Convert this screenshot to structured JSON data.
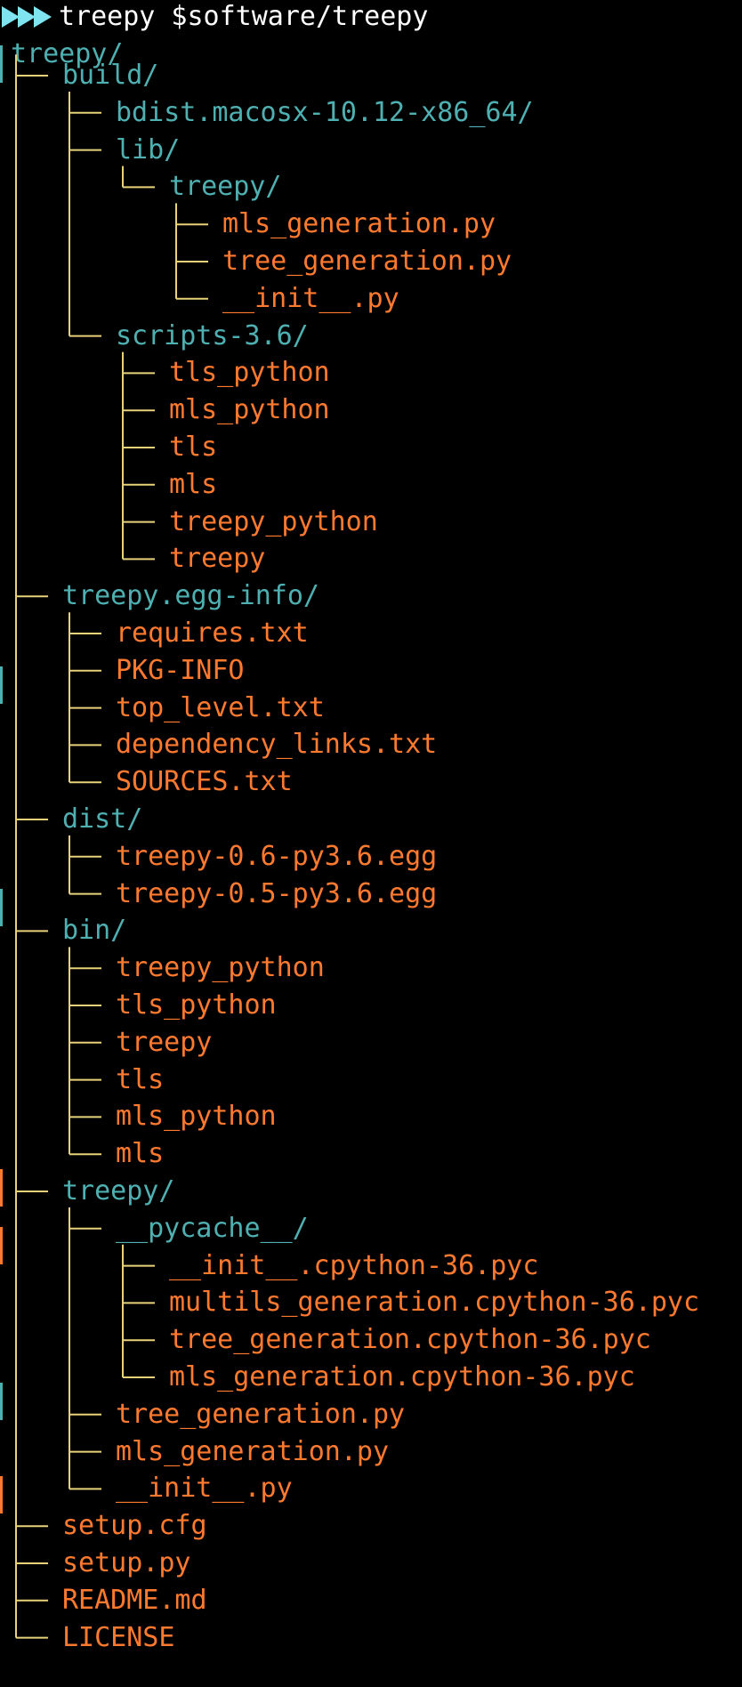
{
  "colors": {
    "background": "#000000",
    "prompt": "#ffffff",
    "dir": "#4fb0b2",
    "file": "#ff7a2f",
    "connector": "#e8d27a",
    "prompt_icon": "#7fe3f0"
  },
  "prompt": {
    "icon": "double-triangle-prompt-icon",
    "text": "treepy $software/treepy"
  },
  "root": {
    "label": "treepy/"
  },
  "tree": [
    {
      "label": "build/",
      "type": "dir",
      "children": [
        {
          "label": "bdist.macosx-10.12-x86_64/",
          "type": "dir"
        },
        {
          "label": "lib/",
          "type": "dir",
          "children": [
            {
              "label": "treepy/",
              "type": "dir",
              "children": [
                {
                  "label": "mls_generation.py",
                  "type": "file"
                },
                {
                  "label": "tree_generation.py",
                  "type": "file"
                },
                {
                  "label": "__init__.py",
                  "type": "file"
                }
              ]
            }
          ]
        },
        {
          "label": "scripts-3.6/",
          "type": "dir",
          "children": [
            {
              "label": "tls_python",
              "type": "file"
            },
            {
              "label": "mls_python",
              "type": "file"
            },
            {
              "label": "tls",
              "type": "file"
            },
            {
              "label": "mls",
              "type": "file"
            },
            {
              "label": "treepy_python",
              "type": "file"
            },
            {
              "label": "treepy",
              "type": "file"
            }
          ]
        }
      ]
    },
    {
      "label": "treepy.egg-info/",
      "type": "dir",
      "children": [
        {
          "label": "requires.txt",
          "type": "file"
        },
        {
          "label": "PKG-INFO",
          "type": "file"
        },
        {
          "label": "top_level.txt",
          "type": "file"
        },
        {
          "label": "dependency_links.txt",
          "type": "file"
        },
        {
          "label": "SOURCES.txt",
          "type": "file"
        }
      ]
    },
    {
      "label": "dist/",
      "type": "dir",
      "children": [
        {
          "label": "treepy-0.6-py3.6.egg",
          "type": "file"
        },
        {
          "label": "treepy-0.5-py3.6.egg",
          "type": "file"
        }
      ]
    },
    {
      "label": "bin/",
      "type": "dir",
      "children": [
        {
          "label": "treepy_python",
          "type": "file"
        },
        {
          "label": "tls_python",
          "type": "file"
        },
        {
          "label": "treepy",
          "type": "file"
        },
        {
          "label": "tls",
          "type": "file"
        },
        {
          "label": "mls_python",
          "type": "file"
        },
        {
          "label": "mls",
          "type": "file"
        }
      ]
    },
    {
      "label": "treepy/",
      "type": "dir",
      "children": [
        {
          "label": "__pycache__/",
          "type": "dir",
          "children": [
            {
              "label": "__init__.cpython-36.pyc",
              "type": "file"
            },
            {
              "label": "multils_generation.cpython-36.pyc",
              "type": "file"
            },
            {
              "label": "tree_generation.cpython-36.pyc",
              "type": "file"
            },
            {
              "label": "mls_generation.cpython-36.pyc",
              "type": "file"
            }
          ]
        },
        {
          "label": "tree_generation.py",
          "type": "file"
        },
        {
          "label": "mls_generation.py",
          "type": "file"
        },
        {
          "label": "__init__.py",
          "type": "file"
        }
      ]
    },
    {
      "label": "setup.cfg",
      "type": "file"
    },
    {
      "label": "setup.py",
      "type": "file"
    },
    {
      "label": "README.md",
      "type": "file"
    },
    {
      "label": "LICENSE",
      "type": "file"
    }
  ]
}
